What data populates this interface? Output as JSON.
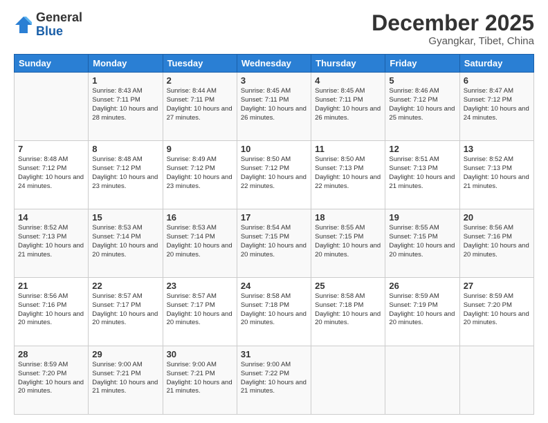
{
  "logo": {
    "general": "General",
    "blue": "Blue"
  },
  "title": "December 2025",
  "location": "Gyangkar, Tibet, China",
  "days_of_week": [
    "Sunday",
    "Monday",
    "Tuesday",
    "Wednesday",
    "Thursday",
    "Friday",
    "Saturday"
  ],
  "weeks": [
    [
      {
        "day": "",
        "sunrise": "",
        "sunset": "",
        "daylight": ""
      },
      {
        "day": "1",
        "sunrise": "Sunrise: 8:43 AM",
        "sunset": "Sunset: 7:11 PM",
        "daylight": "Daylight: 10 hours and 28 minutes."
      },
      {
        "day": "2",
        "sunrise": "Sunrise: 8:44 AM",
        "sunset": "Sunset: 7:11 PM",
        "daylight": "Daylight: 10 hours and 27 minutes."
      },
      {
        "day": "3",
        "sunrise": "Sunrise: 8:45 AM",
        "sunset": "Sunset: 7:11 PM",
        "daylight": "Daylight: 10 hours and 26 minutes."
      },
      {
        "day": "4",
        "sunrise": "Sunrise: 8:45 AM",
        "sunset": "Sunset: 7:11 PM",
        "daylight": "Daylight: 10 hours and 26 minutes."
      },
      {
        "day": "5",
        "sunrise": "Sunrise: 8:46 AM",
        "sunset": "Sunset: 7:12 PM",
        "daylight": "Daylight: 10 hours and 25 minutes."
      },
      {
        "day": "6",
        "sunrise": "Sunrise: 8:47 AM",
        "sunset": "Sunset: 7:12 PM",
        "daylight": "Daylight: 10 hours and 24 minutes."
      }
    ],
    [
      {
        "day": "7",
        "sunrise": "Sunrise: 8:48 AM",
        "sunset": "Sunset: 7:12 PM",
        "daylight": "Daylight: 10 hours and 24 minutes."
      },
      {
        "day": "8",
        "sunrise": "Sunrise: 8:48 AM",
        "sunset": "Sunset: 7:12 PM",
        "daylight": "Daylight: 10 hours and 23 minutes."
      },
      {
        "day": "9",
        "sunrise": "Sunrise: 8:49 AM",
        "sunset": "Sunset: 7:12 PM",
        "daylight": "Daylight: 10 hours and 23 minutes."
      },
      {
        "day": "10",
        "sunrise": "Sunrise: 8:50 AM",
        "sunset": "Sunset: 7:12 PM",
        "daylight": "Daylight: 10 hours and 22 minutes."
      },
      {
        "day": "11",
        "sunrise": "Sunrise: 8:50 AM",
        "sunset": "Sunset: 7:13 PM",
        "daylight": "Daylight: 10 hours and 22 minutes."
      },
      {
        "day": "12",
        "sunrise": "Sunrise: 8:51 AM",
        "sunset": "Sunset: 7:13 PM",
        "daylight": "Daylight: 10 hours and 21 minutes."
      },
      {
        "day": "13",
        "sunrise": "Sunrise: 8:52 AM",
        "sunset": "Sunset: 7:13 PM",
        "daylight": "Daylight: 10 hours and 21 minutes."
      }
    ],
    [
      {
        "day": "14",
        "sunrise": "Sunrise: 8:52 AM",
        "sunset": "Sunset: 7:13 PM",
        "daylight": "Daylight: 10 hours and 21 minutes."
      },
      {
        "day": "15",
        "sunrise": "Sunrise: 8:53 AM",
        "sunset": "Sunset: 7:14 PM",
        "daylight": "Daylight: 10 hours and 20 minutes."
      },
      {
        "day": "16",
        "sunrise": "Sunrise: 8:53 AM",
        "sunset": "Sunset: 7:14 PM",
        "daylight": "Daylight: 10 hours and 20 minutes."
      },
      {
        "day": "17",
        "sunrise": "Sunrise: 8:54 AM",
        "sunset": "Sunset: 7:15 PM",
        "daylight": "Daylight: 10 hours and 20 minutes."
      },
      {
        "day": "18",
        "sunrise": "Sunrise: 8:55 AM",
        "sunset": "Sunset: 7:15 PM",
        "daylight": "Daylight: 10 hours and 20 minutes."
      },
      {
        "day": "19",
        "sunrise": "Sunrise: 8:55 AM",
        "sunset": "Sunset: 7:15 PM",
        "daylight": "Daylight: 10 hours and 20 minutes."
      },
      {
        "day": "20",
        "sunrise": "Sunrise: 8:56 AM",
        "sunset": "Sunset: 7:16 PM",
        "daylight": "Daylight: 10 hours and 20 minutes."
      }
    ],
    [
      {
        "day": "21",
        "sunrise": "Sunrise: 8:56 AM",
        "sunset": "Sunset: 7:16 PM",
        "daylight": "Daylight: 10 hours and 20 minutes."
      },
      {
        "day": "22",
        "sunrise": "Sunrise: 8:57 AM",
        "sunset": "Sunset: 7:17 PM",
        "daylight": "Daylight: 10 hours and 20 minutes."
      },
      {
        "day": "23",
        "sunrise": "Sunrise: 8:57 AM",
        "sunset": "Sunset: 7:17 PM",
        "daylight": "Daylight: 10 hours and 20 minutes."
      },
      {
        "day": "24",
        "sunrise": "Sunrise: 8:58 AM",
        "sunset": "Sunset: 7:18 PM",
        "daylight": "Daylight: 10 hours and 20 minutes."
      },
      {
        "day": "25",
        "sunrise": "Sunrise: 8:58 AM",
        "sunset": "Sunset: 7:18 PM",
        "daylight": "Daylight: 10 hours and 20 minutes."
      },
      {
        "day": "26",
        "sunrise": "Sunrise: 8:59 AM",
        "sunset": "Sunset: 7:19 PM",
        "daylight": "Daylight: 10 hours and 20 minutes."
      },
      {
        "day": "27",
        "sunrise": "Sunrise: 8:59 AM",
        "sunset": "Sunset: 7:20 PM",
        "daylight": "Daylight: 10 hours and 20 minutes."
      }
    ],
    [
      {
        "day": "28",
        "sunrise": "Sunrise: 8:59 AM",
        "sunset": "Sunset: 7:20 PM",
        "daylight": "Daylight: 10 hours and 20 minutes."
      },
      {
        "day": "29",
        "sunrise": "Sunrise: 9:00 AM",
        "sunset": "Sunset: 7:21 PM",
        "daylight": "Daylight: 10 hours and 21 minutes."
      },
      {
        "day": "30",
        "sunrise": "Sunrise: 9:00 AM",
        "sunset": "Sunset: 7:21 PM",
        "daylight": "Daylight: 10 hours and 21 minutes."
      },
      {
        "day": "31",
        "sunrise": "Sunrise: 9:00 AM",
        "sunset": "Sunset: 7:22 PM",
        "daylight": "Daylight: 10 hours and 21 minutes."
      },
      {
        "day": "",
        "sunrise": "",
        "sunset": "",
        "daylight": ""
      },
      {
        "day": "",
        "sunrise": "",
        "sunset": "",
        "daylight": ""
      },
      {
        "day": "",
        "sunrise": "",
        "sunset": "",
        "daylight": ""
      }
    ]
  ]
}
